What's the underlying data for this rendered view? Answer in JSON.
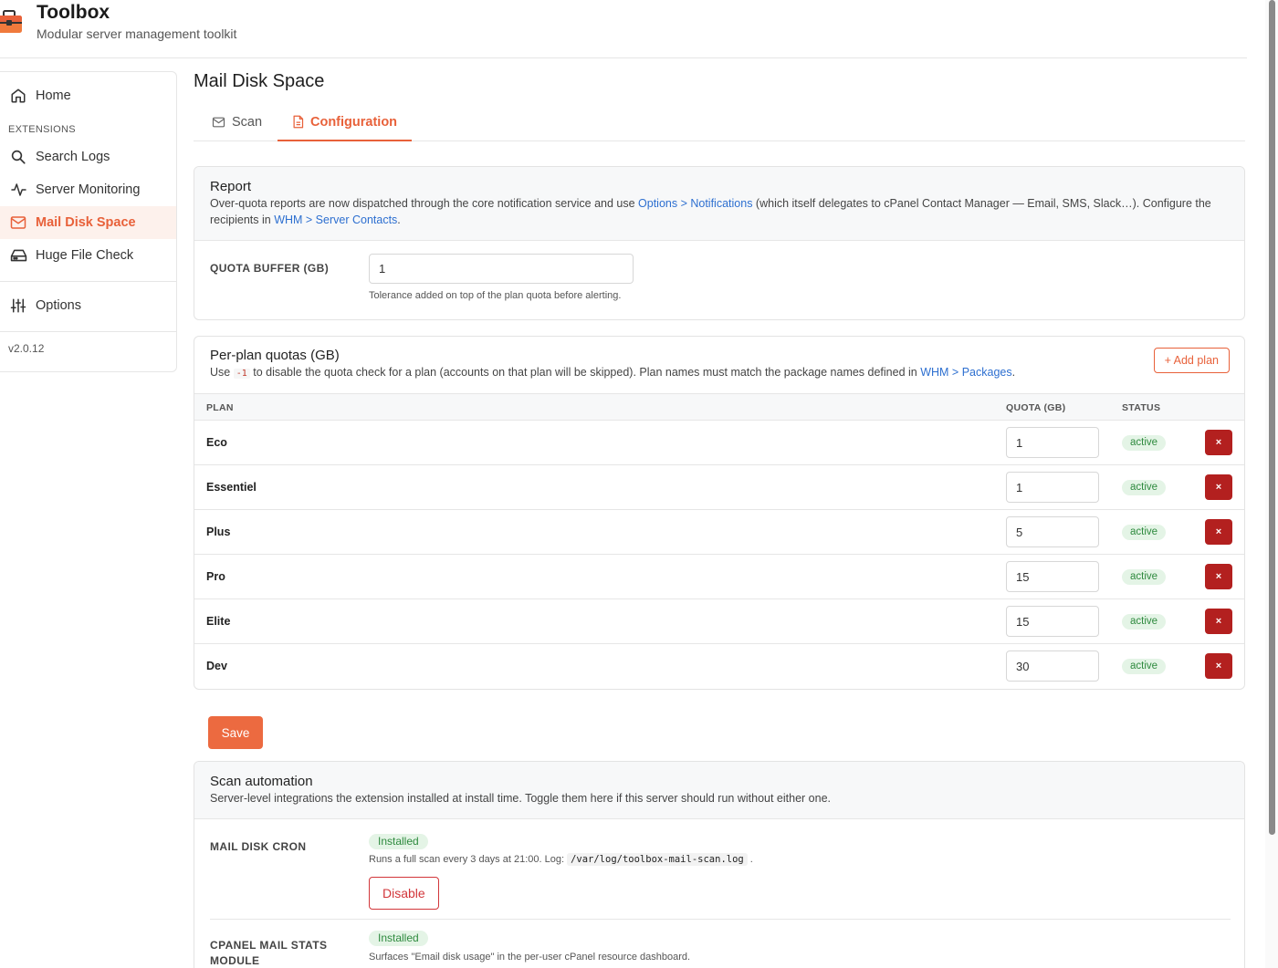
{
  "app": {
    "title": "Toolbox",
    "subtitle": "Modular server management toolkit"
  },
  "sidebar": {
    "home": "Home",
    "section_label": "EXTENSIONS",
    "items": [
      {
        "label": "Search Logs",
        "icon": "search-icon"
      },
      {
        "label": "Server Monitoring",
        "icon": "pulse-icon"
      },
      {
        "label": "Mail Disk Space",
        "icon": "mail-icon",
        "active": true
      },
      {
        "label": "Huge File Check",
        "icon": "hard-drive-icon"
      }
    ],
    "options": "Options",
    "version": "v2.0.12"
  },
  "page": {
    "title": "Mail Disk Space",
    "tabs": [
      {
        "label": "Scan",
        "icon": "mail-icon"
      },
      {
        "label": "Configuration",
        "icon": "document-icon",
        "active": true
      }
    ]
  },
  "report": {
    "title": "Report",
    "desc_part1": "Over-quota reports are now dispatched through the core notification service and use ",
    "link1": "Options > Notifications",
    "desc_part2": " (which itself delegates to cPanel Contact Manager — Email, SMS, Slack…). Configure the recipients in ",
    "link2": "WHM > Server Contacts",
    "desc_part3": ".",
    "quota_buffer_label": "QUOTA BUFFER (GB)",
    "quota_buffer_value": "1",
    "quota_buffer_help": "Tolerance added on top of the plan quota before alerting."
  },
  "plans": {
    "title": "Per-plan quotas (GB)",
    "desc_part1": "Use ",
    "desc_code": "-1",
    "desc_part2": " to disable the quota check for a plan (accounts on that plan will be skipped). Plan names must match the package names defined in ",
    "link": "WHM > Packages",
    "desc_part3": ".",
    "add_button": "+ Add plan",
    "columns": {
      "plan": "PLAN",
      "quota": "QUOTA (GB)",
      "status": "STATUS"
    },
    "rows": [
      {
        "name": "Eco",
        "quota": "1",
        "status": "active"
      },
      {
        "name": "Essentiel",
        "quota": "1",
        "status": "active"
      },
      {
        "name": "Plus",
        "quota": "5",
        "status": "active"
      },
      {
        "name": "Pro",
        "quota": "15",
        "status": "active"
      },
      {
        "name": "Elite",
        "quota": "15",
        "status": "active"
      },
      {
        "name": "Dev",
        "quota": "30",
        "status": "active"
      }
    ],
    "delete_label": "×"
  },
  "save_button": "Save",
  "automation": {
    "title": "Scan automation",
    "desc": "Server-level integrations the extension installed at install time. Toggle them here if this server should run without either one.",
    "cron": {
      "label": "MAIL DISK CRON",
      "badge": "Installed",
      "desc_part1": "Runs a full scan every 3 days at 21:00. Log: ",
      "log_path": "/var/log/toolbox-mail-scan.log",
      "desc_part2": ".",
      "button": "Disable"
    },
    "stats": {
      "label_line1": "CPANEL MAIL STATS",
      "label_line2": "MODULE",
      "badge": "Installed",
      "desc": "Surfaces \"Email disk usage\" in the per-user cPanel resource dashboard."
    }
  },
  "colors": {
    "accent": "#e8613a",
    "danger": "#b3201f",
    "success_bg": "#e4f4e6",
    "success_text": "#2e8a3e",
    "link": "#2d6fd0"
  }
}
